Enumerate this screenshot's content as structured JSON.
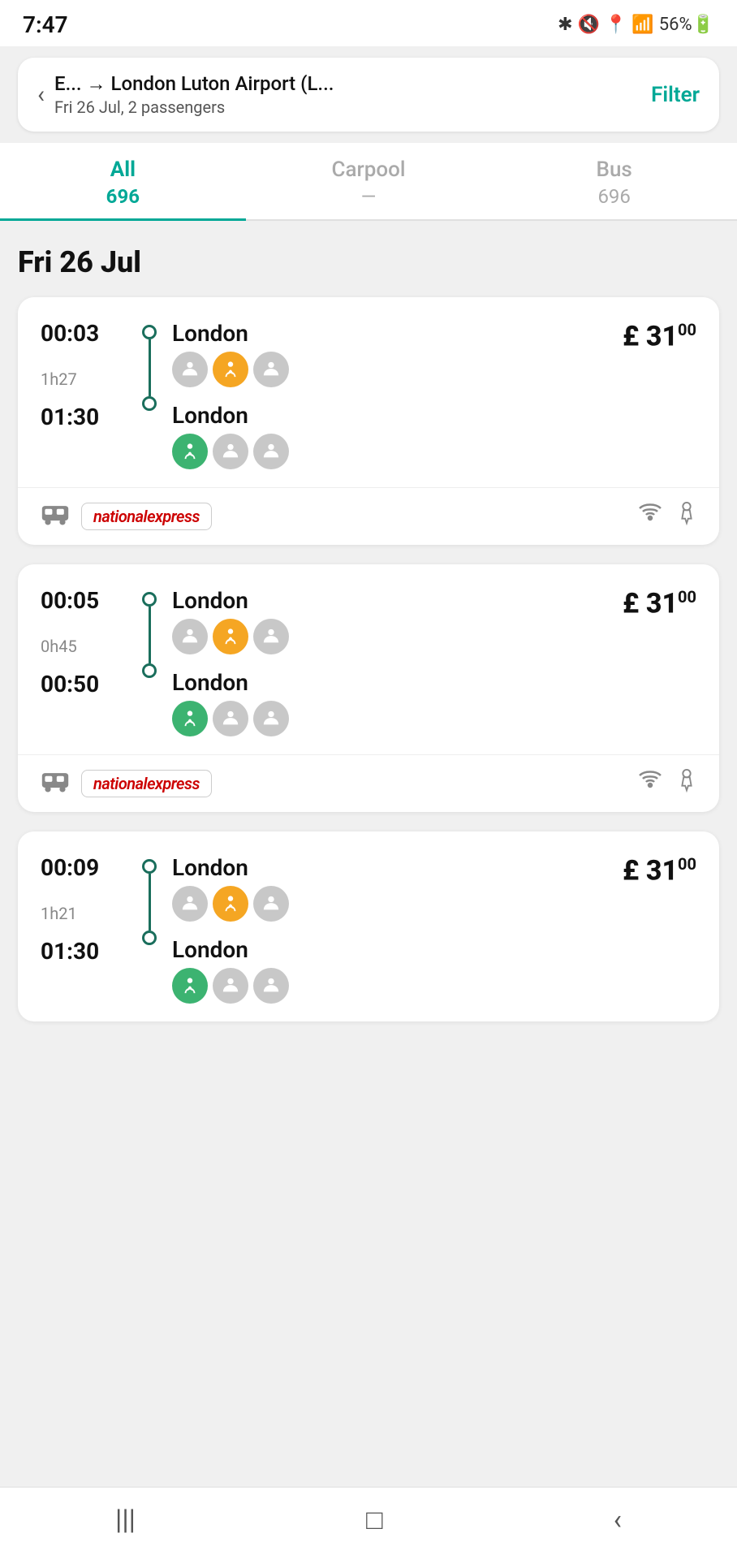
{
  "statusBar": {
    "time": "7:47",
    "icons": "🎵 📵 📍 📶 56% 🔋"
  },
  "searchBar": {
    "route": "E... → London Luton Airport (L...",
    "details": "Fri 26 Jul, 2 passengers",
    "filterLabel": "Filter",
    "backArrow": "‹"
  },
  "tabs": [
    {
      "id": "all",
      "label": "All",
      "count": "696",
      "active": true
    },
    {
      "id": "carpool",
      "label": "Carpool",
      "count": "—",
      "active": false
    },
    {
      "id": "bus",
      "label": "Bus",
      "count": "696",
      "active": false
    }
  ],
  "dateHeader": "Fri 26 Jul",
  "trips": [
    {
      "id": 1,
      "departureTime": "00:03",
      "duration": "1h27",
      "arrivalTime": "01:30",
      "departureStop": "London",
      "arrivalStop": "London",
      "price": "£ 31",
      "priceSup": "00",
      "departurePax": [
        "grey",
        "yellow",
        "grey"
      ],
      "arrivalPax": [
        "green",
        "grey",
        "grey"
      ],
      "operator": "national express",
      "hasWifi": true,
      "hasToilet": true
    },
    {
      "id": 2,
      "departureTime": "00:05",
      "duration": "0h45",
      "arrivalTime": "00:50",
      "departureStop": "London",
      "arrivalStop": "London",
      "price": "£ 31",
      "priceSup": "00",
      "departurePax": [
        "grey",
        "yellow",
        "grey"
      ],
      "arrivalPax": [
        "green",
        "grey",
        "grey"
      ],
      "operator": "national express",
      "hasWifi": true,
      "hasToilet": true
    },
    {
      "id": 3,
      "departureTime": "00:09",
      "duration": "1h21",
      "arrivalTime": "01:30",
      "departureStop": "London",
      "arrivalStop": "London",
      "price": "£ 31",
      "priceSup": "00",
      "departurePax": [
        "grey",
        "yellow",
        "grey"
      ],
      "arrivalPax": [
        "green",
        "grey",
        "grey"
      ],
      "operator": "national express",
      "hasWifi": false,
      "hasToilet": false
    }
  ],
  "bottomNav": {
    "menu": "|||",
    "home": "□",
    "back": "‹"
  },
  "paxColors": {
    "grey": "#c8c8c8",
    "yellow": "#f5a623",
    "green": "#3cb371"
  }
}
